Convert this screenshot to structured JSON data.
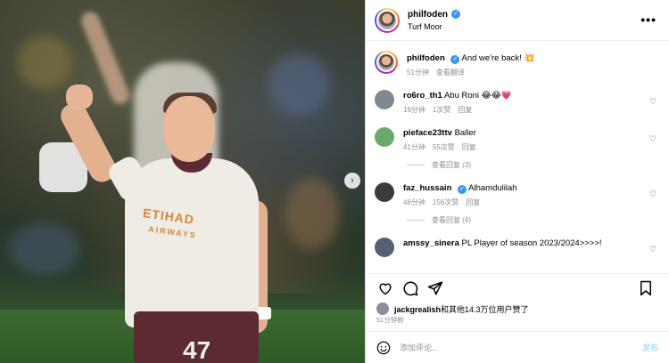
{
  "post": {
    "username": "philfoden",
    "location": "Turf Moor",
    "more_label": "•••",
    "caption_text": "And we're back! 💥",
    "caption_time": "51分钟",
    "caption_translate": "查看翻译"
  },
  "photo": {
    "sponsor": "ETIHAD",
    "sponsor_sub": "AIRWAYS",
    "shirt_number": "47",
    "next_arrow": "›"
  },
  "comments": [
    {
      "username": "ro6ro_th1",
      "verified": false,
      "text": "Abu Roni 😂😂💗",
      "time": "16分钟",
      "likes": "1次赞",
      "reply": "回复",
      "avatar_color": "#7d8a8f"
    },
    {
      "username": "pieface23ttv",
      "verified": false,
      "text": "Baller",
      "time": "41分钟",
      "likes": "55次赞",
      "reply": "回复",
      "view_replies": "查看回复 (3)",
      "avatar_color": "#6ba86b"
    },
    {
      "username": "faz_hussain",
      "verified": true,
      "text": "Alhamdulilah",
      "time": "46分钟",
      "likes": "156次赞",
      "reply": "回复",
      "view_replies": "查看回复 (4)",
      "avatar_color": "#3b3b3b"
    },
    {
      "username": "amssy_sinera",
      "verified": false,
      "text": "PL Player of season 2023/2024>>>>!",
      "time": "",
      "likes": "",
      "reply": "",
      "avatar_color": "#556070"
    }
  ],
  "likes": {
    "liked_by": "jackgrealish",
    "suffix": "和其他14.3万位用户赞了"
  },
  "post_time": "51分钟前",
  "composer": {
    "placeholder": "添加评论...",
    "post_label": "发布"
  }
}
